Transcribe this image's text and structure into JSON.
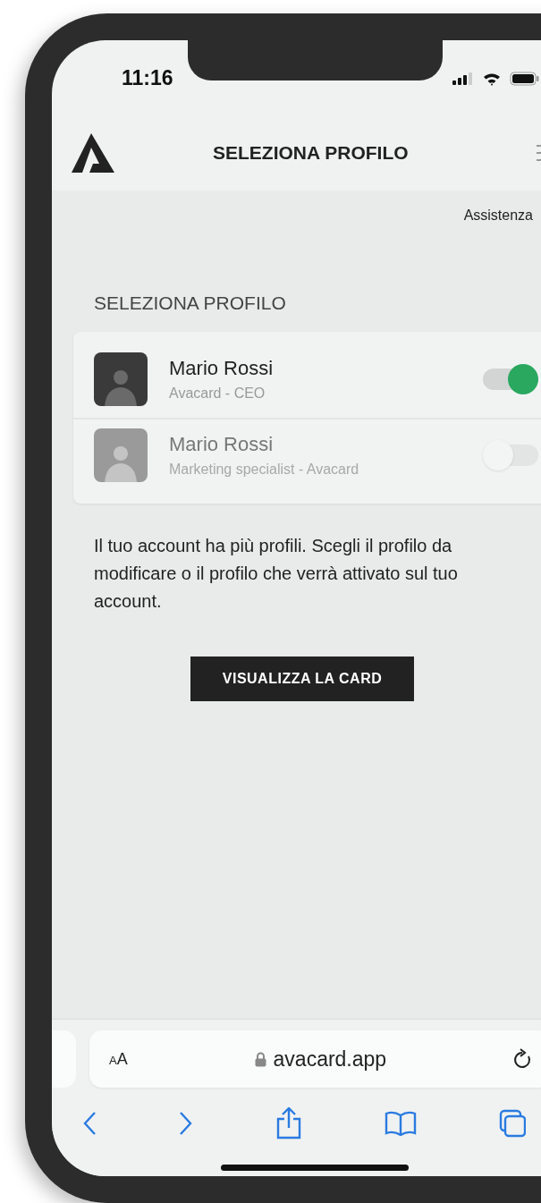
{
  "status_bar": {
    "time": "11:16"
  },
  "header": {
    "title": "SELEZIONA PROFILO"
  },
  "help_link": {
    "label": "Assistenza"
  },
  "section_title": "SELEZIONA PROFILO",
  "profiles": [
    {
      "name": "Mario Rossi",
      "role": "Avacard - CEO",
      "on": true
    },
    {
      "name": "Mario Rossi",
      "role": "Marketing specialist - Avacard",
      "on": false
    }
  ],
  "description": "Il tuo account ha più profili. Scegli il profilo da modificare o il profilo che verrà attivato sul tuo account.",
  "view_card_button": "VISUALIZZA LA CARD",
  "browser": {
    "text_size_button": "AA",
    "url": "avacard.app"
  }
}
